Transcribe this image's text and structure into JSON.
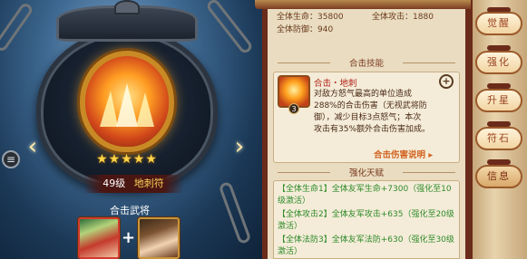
{
  "left": {
    "level": "49级",
    "name": "地刺符",
    "stars": "★★★★★",
    "combo_label": "合击武将",
    "plus": "+",
    "menu_glyph": "≡",
    "left_arrow": "‹",
    "right_arrow": "›"
  },
  "stats": {
    "hp": "全体生命|35800",
    "atk": "全体攻击|1880",
    "def": "全体防御|940"
  },
  "combo_skill": {
    "section_title": "合击技能",
    "name": "合击・地刺",
    "badge": "3",
    "desc_lines": [
      "对敌方怒气最高的单位造成",
      "288%的合击伤害（无视武将防",
      "御），减少目标3点怒气；本次",
      "攻击有35%额外合击伤害加成。"
    ],
    "link": "合击伤害说明",
    "zoom_glyph": "+"
  },
  "talent": {
    "section_title": "强化天赋",
    "items": [
      "【全体生命1】全体友军生命+7300（强化至10级激活）",
      "【全体攻击2】全体友军攻击+635（强化至20级激活）",
      "【全体法防3】全体友军法防+630（强化至30级激活）"
    ]
  },
  "tabs": [
    "觉醒",
    "强化",
    "升星",
    "符石",
    "信息"
  ],
  "active_tab": "信息",
  "colors": {
    "panel_bg": "#e9dcc1",
    "frame": "#6b2b1a",
    "talent_green": "#2f8a2a",
    "highlight_red": "#b2241a",
    "link_orange": "#d2611e"
  }
}
